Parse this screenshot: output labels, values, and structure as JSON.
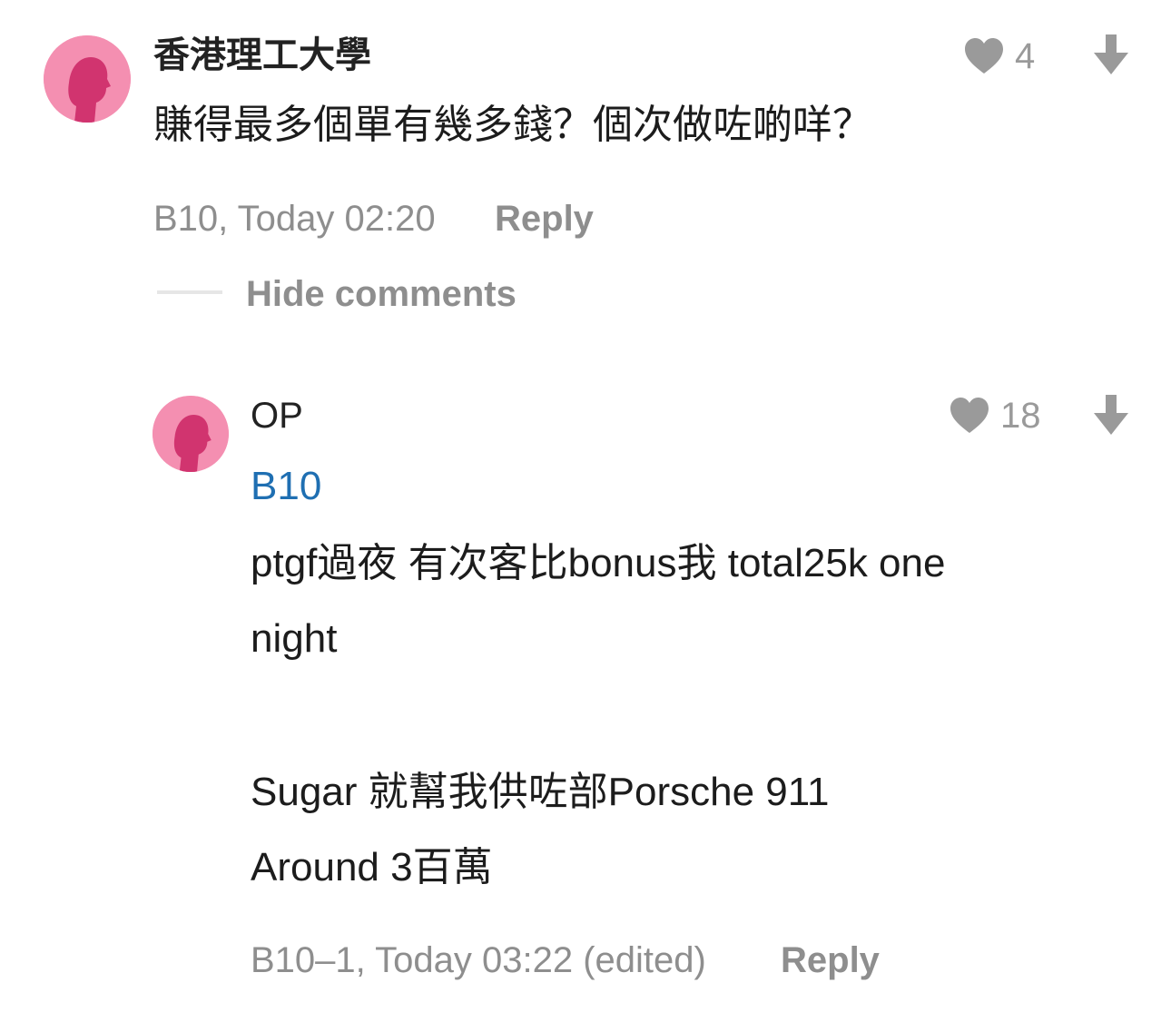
{
  "comment": {
    "author": "香港理工大學",
    "text": "賺得最多個單有幾多錢？個次做咗啲咩？",
    "meta": "B10, Today 02:20",
    "reply_label": "Reply",
    "likes": "4",
    "avatar_color": "#f48fb1",
    "silhouette_color": "#d1346f"
  },
  "thread": {
    "hide_comments_label": "Hide comments"
  },
  "reply": {
    "author": "OP",
    "quote_ref": "B10",
    "lines": [
      "ptgf過夜 有次客比bonus我 total25k one",
      "night",
      "Sugar 就幫我供咗部Porsche 911",
      "Around 3百萬"
    ],
    "meta": "B10–1, Today 03:22 (edited)",
    "reply_label": "Reply",
    "likes": "18"
  },
  "icons": {
    "like": "heart-icon",
    "downvote": "arrow-down-icon"
  },
  "colors": {
    "link": "#1f6fb2",
    "muted": "#8e8e8e",
    "icon": "#9a9a9a"
  }
}
